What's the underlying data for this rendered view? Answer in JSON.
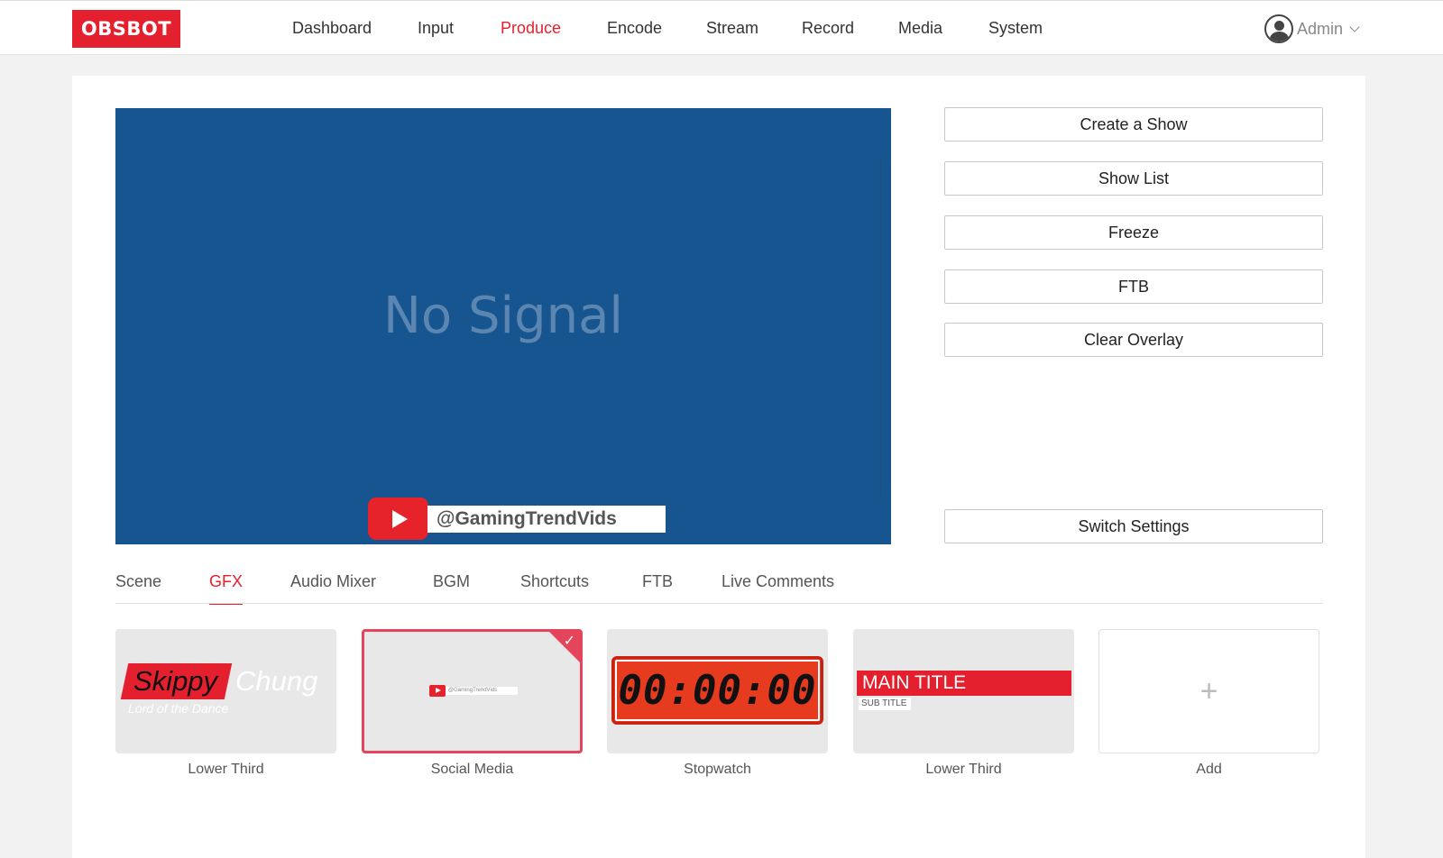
{
  "header": {
    "logo": "OBSBOT",
    "nav": [
      "Dashboard",
      "Input",
      "Produce",
      "Encode",
      "Stream",
      "Record",
      "Media",
      "System"
    ],
    "active_nav": "Produce",
    "user": "Admin"
  },
  "preview": {
    "status": "No Signal",
    "overlay_handle": "@GamingTrendVids"
  },
  "actions": {
    "create_show": "Create a Show",
    "show_list": "Show List",
    "freeze": "Freeze",
    "ftb": "FTB",
    "clear_overlay": "Clear Overlay",
    "switch_settings": "Switch Settings"
  },
  "tabs": [
    "Scene",
    "GFX",
    "Audio Mixer",
    "BGM",
    "Shortcuts",
    "FTB",
    "Live Comments"
  ],
  "active_tab": "GFX",
  "gfx": [
    {
      "label": "Lower Third",
      "first_name": "Skippy",
      "last_name": "Chung",
      "subtitle": "Lord of the Dance"
    },
    {
      "label": "Social Media",
      "handle": "@GamingTrendVids",
      "selected": true
    },
    {
      "label": "Stopwatch",
      "time": "00:00:00"
    },
    {
      "label": "Lower Third",
      "main_title": "MAIN TITLE",
      "sub_title": "SUB TITLE"
    },
    {
      "label": "Add",
      "symbol": "+"
    }
  ],
  "colors": {
    "accent": "#e5202e",
    "preview_bg": "#16558f"
  }
}
